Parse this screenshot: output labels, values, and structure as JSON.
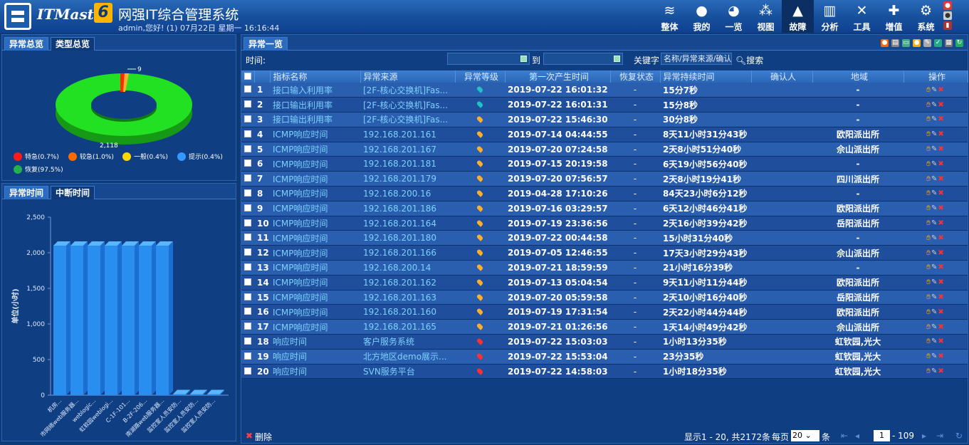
{
  "app": {
    "brand": "ITMaster",
    "brand_version": "6",
    "title": "网强IT综合管理系统",
    "user_line": "admin,您好! (1) 07月22日 星期一 16:16:44"
  },
  "nav": [
    {
      "label": "整体",
      "icon": "layers-icon",
      "glyph": "≋"
    },
    {
      "label": "我的",
      "icon": "user-icon",
      "glyph": "●"
    },
    {
      "label": "一览",
      "icon": "globe-icon",
      "glyph": "◕"
    },
    {
      "label": "视图",
      "icon": "topology-icon",
      "glyph": "⁂"
    },
    {
      "label": "故障",
      "icon": "warning-icon",
      "glyph": "▲",
      "active": true
    },
    {
      "label": "分析",
      "icon": "chart-icon",
      "glyph": "▥"
    },
    {
      "label": "工具",
      "icon": "tools-icon",
      "glyph": "✕"
    },
    {
      "label": "增值",
      "icon": "plus-icon",
      "glyph": "✚"
    },
    {
      "label": "系统",
      "icon": "gear-icon",
      "glyph": "⚙"
    }
  ],
  "left_top": {
    "tabs": [
      "异常总览",
      "类型总览"
    ],
    "pie_labels": {
      "top": "9",
      "bottom": "2,118"
    },
    "legend": [
      {
        "label": "特急(0.7%)",
        "color": "#ff1a1a"
      },
      {
        "label": "较急(1.0%)",
        "color": "#ff6a00"
      },
      {
        "label": "一般(0.4%)",
        "color": "#ffd700"
      },
      {
        "label": "提示(0.4%)",
        "color": "#3399ff"
      },
      {
        "label": "恢复(97.5%)",
        "color": "#22b14c"
      }
    ]
  },
  "left_bottom": {
    "tabs": [
      "异常时间",
      "中断时间"
    ],
    "ylabel": "单位(小时)",
    "yticks": [
      "2,500",
      "2,000",
      "1,500",
      "1,000",
      "500",
      "0"
    ],
    "xlabels": [
      "机房...",
      "市网络web服务器...",
      "weblogic...",
      "虹软园weblogi...",
      "C-1F-101...",
      "B-2F-206...",
      "南湖路web服务器...",
      "监控室人员安防...",
      "监控室人员安防...",
      "监控室人员安防..."
    ]
  },
  "chart_data": {
    "type": "bar",
    "title": "",
    "ylabel": "单位(小时)",
    "ylim": [
      0,
      2500
    ],
    "categories": [
      "机房...",
      "市网络web服务器...",
      "weblogic...",
      "虹软园weblogi...",
      "C-1F-101...",
      "B-2F-206...",
      "南湖路web服务器...",
      "监控室人员安防...",
      "监控室人员安防...",
      "监控室人员安防..."
    ],
    "values": [
      2100,
      2100,
      2100,
      2100,
      2100,
      2100,
      2100,
      15,
      15,
      15
    ]
  },
  "main": {
    "tab": "异常一览",
    "time_label": "时间:",
    "to_label": "到",
    "keyword_label": "关键字",
    "keyword_placeholder": "名称/异常来源/确认人",
    "search_label": "搜索",
    "columns": [
      "指标名称",
      "异常来源",
      "异常等级",
      "第一次产生时间",
      "恢复状态",
      "异常持续时间",
      "确认人",
      "地域",
      "操作"
    ],
    "rows": [
      {
        "no": "1",
        "name": "接口输入利用率",
        "source": "[2F-核心交换机]Fas...",
        "level": "teal",
        "time": "2019-07-22 16:01:32",
        "status": "-",
        "duration": "15分7秒",
        "confirm": "",
        "region": "-"
      },
      {
        "no": "2",
        "name": "接口输出利用率",
        "source": "[2F-核心交换机]Fas...",
        "level": "teal",
        "time": "2019-07-22 16:01:31",
        "status": "-",
        "duration": "15分8秒",
        "confirm": "",
        "region": "-"
      },
      {
        "no": "3",
        "name": "接口输出利用率",
        "source": "[2F-核心交换机]Fas...",
        "level": "orange",
        "time": "2019-07-22 15:46:30",
        "status": "-",
        "duration": "30分8秒",
        "confirm": "",
        "region": "-"
      },
      {
        "no": "4",
        "name": "ICMP响应时间",
        "source": "192.168.201.161",
        "level": "orange",
        "time": "2019-07-14 04:44:55",
        "status": "-",
        "duration": "8天11小时31分43秒",
        "confirm": "",
        "region": "欧阳派出所"
      },
      {
        "no": "5",
        "name": "ICMP响应时间",
        "source": "192.168.201.167",
        "level": "orange",
        "time": "2019-07-20 07:24:58",
        "status": "-",
        "duration": "2天8小时51分40秒",
        "confirm": "",
        "region": "佘山派出所"
      },
      {
        "no": "6",
        "name": "ICMP响应时间",
        "source": "192.168.201.181",
        "level": "orange",
        "time": "2019-07-15 20:19:58",
        "status": "-",
        "duration": "6天19小时56分40秒",
        "confirm": "",
        "region": "-"
      },
      {
        "no": "7",
        "name": "ICMP响应时间",
        "source": "192.168.201.179",
        "level": "orange",
        "time": "2019-07-20 07:56:57",
        "status": "-",
        "duration": "2天8小时19分41秒",
        "confirm": "",
        "region": "四川派出所"
      },
      {
        "no": "8",
        "name": "ICMP响应时间",
        "source": "192.168.200.16",
        "level": "orange",
        "time": "2019-04-28 17:10:26",
        "status": "-",
        "duration": "84天23小时6分12秒",
        "confirm": "",
        "region": "-"
      },
      {
        "no": "9",
        "name": "ICMP响应时间",
        "source": "192.168.201.186",
        "level": "orange",
        "time": "2019-07-16 03:29:57",
        "status": "-",
        "duration": "6天12小时46分41秒",
        "confirm": "",
        "region": "欧阳派出所"
      },
      {
        "no": "10",
        "name": "ICMP响应时间",
        "source": "192.168.201.164",
        "level": "orange",
        "time": "2019-07-19 23:36:56",
        "status": "-",
        "duration": "2天16小时39分42秒",
        "confirm": "",
        "region": "岳阳派出所"
      },
      {
        "no": "11",
        "name": "ICMP响应时间",
        "source": "192.168.201.180",
        "level": "orange",
        "time": "2019-07-22 00:44:58",
        "status": "-",
        "duration": "15小时31分40秒",
        "confirm": "",
        "region": "-"
      },
      {
        "no": "12",
        "name": "ICMP响应时间",
        "source": "192.168.201.166",
        "level": "orange",
        "time": "2019-07-05 12:46:55",
        "status": "-",
        "duration": "17天3小时29分43秒",
        "confirm": "",
        "region": "佘山派出所"
      },
      {
        "no": "13",
        "name": "ICMP响应时间",
        "source": "192.168.200.14",
        "level": "orange",
        "time": "2019-07-21 18:59:59",
        "status": "-",
        "duration": "21小时16分39秒",
        "confirm": "",
        "region": "-"
      },
      {
        "no": "14",
        "name": "ICMP响应时间",
        "source": "192.168.201.162",
        "level": "orange",
        "time": "2019-07-13 05:04:54",
        "status": "-",
        "duration": "9天11小时11分44秒",
        "confirm": "",
        "region": "欧阳派出所"
      },
      {
        "no": "15",
        "name": "ICMP响应时间",
        "source": "192.168.201.163",
        "level": "orange",
        "time": "2019-07-20 05:59:58",
        "status": "-",
        "duration": "2天10小时16分40秒",
        "confirm": "",
        "region": "岳阳派出所"
      },
      {
        "no": "16",
        "name": "ICMP响应时间",
        "source": "192.168.201.160",
        "level": "orange",
        "time": "2019-07-19 17:31:54",
        "status": "-",
        "duration": "2天22小时44分44秒",
        "confirm": "",
        "region": "欧阳派出所"
      },
      {
        "no": "17",
        "name": "ICMP响应时间",
        "source": "192.168.201.165",
        "level": "orange",
        "time": "2019-07-21 01:26:56",
        "status": "-",
        "duration": "1天14小时49分42秒",
        "confirm": "",
        "region": "佘山派出所"
      },
      {
        "no": "18",
        "name": "响应时间",
        "source": "客户服务系统",
        "level": "red",
        "time": "2019-07-22 15:03:03",
        "status": "-",
        "duration": "1小时13分35秒",
        "confirm": "",
        "region": "虹钦园,光大"
      },
      {
        "no": "19",
        "name": "响应时间",
        "source": "北方地区demo展示...",
        "level": "red",
        "time": "2019-07-22 15:53:04",
        "status": "-",
        "duration": "23分35秒",
        "confirm": "",
        "region": "虹钦园,光大"
      },
      {
        "no": "20",
        "name": "响应时间",
        "source": "SVN服务平台",
        "level": "red",
        "time": "2019-07-22 14:58:03",
        "status": "-",
        "duration": "1小时18分35秒",
        "confirm": "",
        "region": "虹钦园,光大"
      }
    ],
    "level_colors": {
      "teal": "#1fc3c3",
      "orange": "#ffae2a",
      "red": "#ff3030"
    },
    "footer": {
      "delete_label": "删除",
      "summary": "显示1 - 20, 共2172条",
      "per_page_label": "每页",
      "per_page_value": "20",
      "per_page_unit": "条",
      "page_value": "1",
      "page_total": "- 109"
    }
  }
}
